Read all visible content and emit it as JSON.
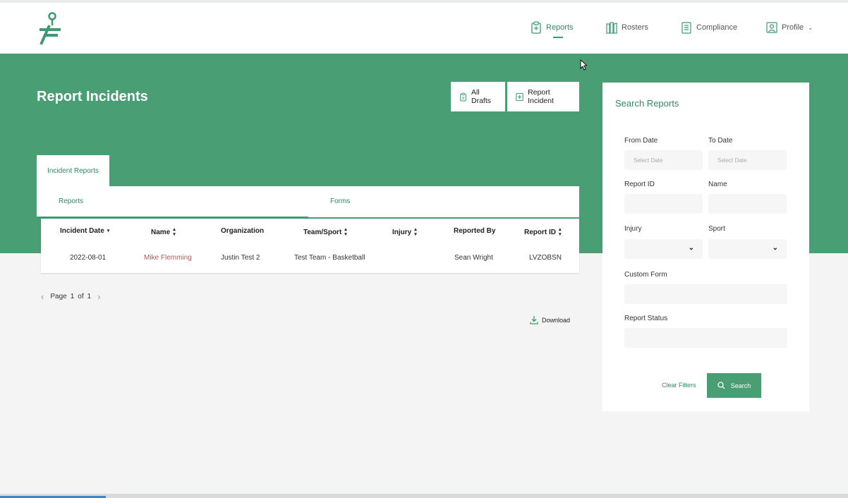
{
  "nav": {
    "items": [
      {
        "label": "Reports",
        "icon": "report-icon",
        "active": true
      },
      {
        "label": "Rosters",
        "icon": "roster-icon"
      },
      {
        "label": "Compliance",
        "icon": "compliance-icon"
      },
      {
        "label": "Profile",
        "icon": "profile-icon",
        "dropdown": true
      }
    ]
  },
  "page": {
    "title": "Report Incidents"
  },
  "actions": {
    "all_drafts": "All Drafts",
    "report_incident": "Report Incident"
  },
  "tabs": {
    "main": "Incident Reports",
    "sub": [
      "Reports",
      "Forms"
    ]
  },
  "table": {
    "headers": [
      "Incident Date",
      "Name",
      "Organization",
      "Team/Sport",
      "Injury",
      "Reported By",
      "Report ID"
    ],
    "rows": [
      [
        "2022-08-01",
        "Mike Flemming",
        "Justin Test 2",
        "Test Team - Basketball",
        "",
        "Sean Wright",
        "LVZOBSN"
      ]
    ]
  },
  "pager": {
    "label": "Page",
    "current": "1",
    "of": "of",
    "total": "1"
  },
  "download": "Download",
  "search": {
    "title": "Search Reports",
    "from_date": {
      "label": "From Date",
      "placeholder": "Select Date"
    },
    "to_date": {
      "label": "To Date",
      "placeholder": "Select Date"
    },
    "report_id": {
      "label": "Report ID"
    },
    "name": {
      "label": "Name"
    },
    "injury": {
      "label": "Injury"
    },
    "sport": {
      "label": "Sport"
    },
    "custom_form": {
      "label": "Custom Form"
    },
    "report_status": {
      "label": "Report Status"
    },
    "clear_label": "Clear Filters",
    "search_label": "Search"
  },
  "colors": {
    "brand": "#4a9e74",
    "accent_text": "#2f8a63",
    "link": "#b35a55"
  }
}
